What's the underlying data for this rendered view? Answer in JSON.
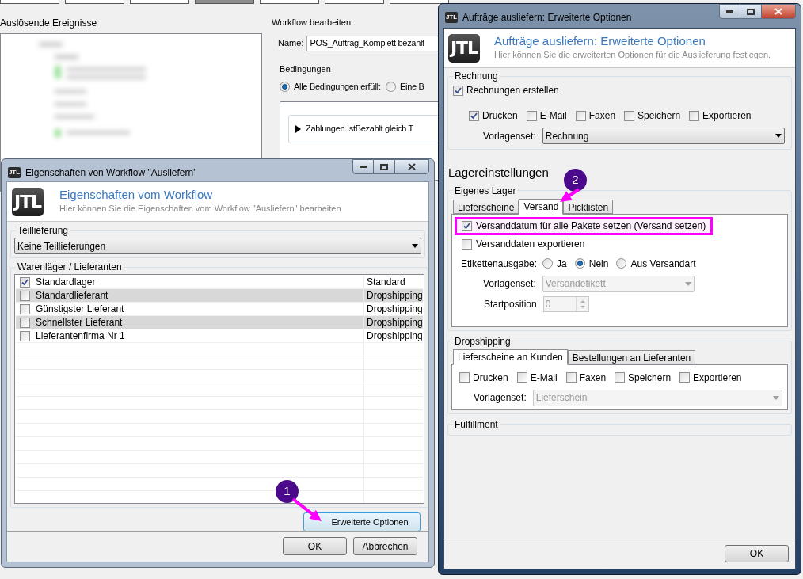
{
  "background": {
    "toolbar_buttons": [
      {
        "selected": false
      },
      {
        "selected": false
      },
      {
        "selected": false
      },
      {
        "selected": true
      },
      {
        "selected": false
      },
      {
        "selected": false
      },
      {
        "selected": false
      }
    ],
    "events_panel": {
      "title": "Auslösende Ereignisse"
    },
    "workflow_panel": {
      "title": "Workflow bearbeiten",
      "name_label": "Name:",
      "name_value": "POS_Auftrag_Komplett bezahlt",
      "conditions_title": "Bedingungen",
      "condition_modes": [
        {
          "label": "Alle Bedingungen erfüllt",
          "selected": true
        },
        {
          "label": "Eine B",
          "selected": false
        }
      ],
      "condition": "Zahlungen.IstBezahlt gleich T"
    }
  },
  "workflow_dialog": {
    "title_logo": "JTL",
    "title": "Eigenschaften von Workflow \"Ausliefern\"",
    "header_logo": "JTL",
    "header_title": "Eigenschaften vom Workflow",
    "header_subtitle": "Hier können Sie die Eigenschaften vom Workflow \"Ausliefern\" bearbeiten",
    "partial_group": "Teillieferung",
    "partial_value": "Keine Teillieferungen",
    "list_group": "Warenläger / Lieferanten",
    "rows": [
      {
        "name": "Standardlager",
        "type": "Standard",
        "checked": true
      },
      {
        "name": "Standardlieferant",
        "type": "Dropshipping",
        "checked": false
      },
      {
        "name": "Günstigster Lieferant",
        "type": "Dropshipping",
        "checked": false
      },
      {
        "name": "Schnellster Lieferant",
        "type": "Dropshipping",
        "checked": false
      },
      {
        "name": "Lieferantenfirma Nr 1",
        "type": "Dropshipping",
        "checked": false
      }
    ],
    "advanced_button": "Erweiterte Optionen",
    "buttons": [
      "OK",
      "Abbrechen"
    ]
  },
  "options_dialog": {
    "title_logo": "JTL",
    "title": "Aufträge ausliefern: Erweiterte Optionen",
    "header_logo": "JTL",
    "header_title": "Aufträge ausliefern: Erweiterte Optionen",
    "header_subtitle": "Hier können Sie die erweiterten Optionen für die Auslieferung festlegen.",
    "invoice": {
      "title": "Rechnung",
      "create_label": "Rechnungen erstellen",
      "create_checked": true,
      "outputs": [
        {
          "label": "Drucken",
          "checked": true
        },
        {
          "label": "E-Mail",
          "checked": false
        },
        {
          "label": "Faxen",
          "checked": false
        },
        {
          "label": "Speichern",
          "checked": false
        },
        {
          "label": "Exportieren",
          "checked": false
        }
      ],
      "template_label": "Vorlagenset:",
      "template_value": "Rechnung"
    },
    "storage_heading": "Lagereinstellungen",
    "own_storage": {
      "title": "Eigenes Lager",
      "tabs": [
        {
          "label": "Lieferscheine",
          "selected": false
        },
        {
          "label": "Versand",
          "selected": true
        },
        {
          "label": "Picklisten",
          "selected": false
        }
      ],
      "options": [
        {
          "label": "Versanddatum für alle Pakete setzen (Versand setzen)",
          "checked": true,
          "highlighted": true
        },
        {
          "label": "Versanddaten exportieren",
          "checked": false,
          "highlighted": false
        }
      ],
      "label_output": "Etikettenausgabe:",
      "label_modes": [
        {
          "label": "Ja",
          "selected": false
        },
        {
          "label": "Nein",
          "selected": true
        },
        {
          "label": "Aus Versandart",
          "selected": false
        }
      ],
      "template_label": "Vorlagenset:",
      "template_value": "Versandetikett",
      "start_label": "Startposition",
      "start_value": "0"
    },
    "dropshipping": {
      "title": "Dropshipping",
      "tabs": [
        {
          "label": "Lieferscheine an Kunden",
          "selected": true
        },
        {
          "label": "Bestellungen an Lieferanten",
          "selected": false
        }
      ],
      "outputs": [
        {
          "label": "Drucken",
          "checked": false
        },
        {
          "label": "E-Mail",
          "checked": false
        },
        {
          "label": "Faxen",
          "checked": false
        },
        {
          "label": "Speichern",
          "checked": false
        },
        {
          "label": "Exportieren",
          "checked": false
        }
      ],
      "template_label": "Vorlagenset:",
      "template_value": "Lieferschein"
    },
    "fulfillment": {
      "title": "Fulfillment"
    },
    "buttons": [
      "OK"
    ]
  },
  "annotations": [
    {
      "label": "1"
    },
    {
      "label": "2"
    }
  ]
}
